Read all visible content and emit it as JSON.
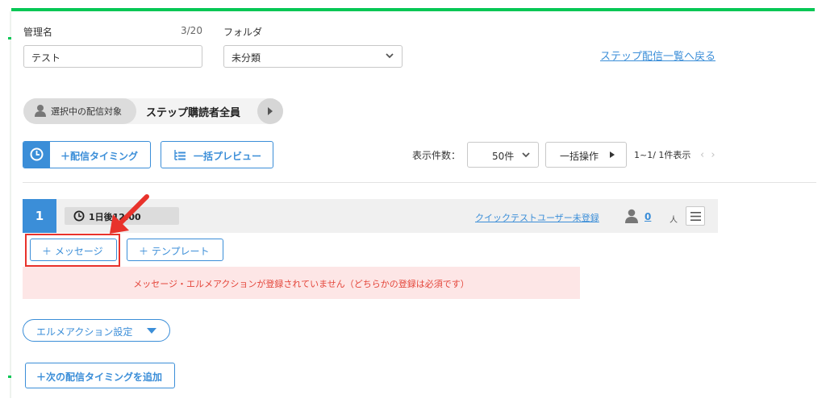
{
  "form": {
    "name_label": "管理名",
    "name_counter": "3/20",
    "name_value": "テスト",
    "folder_label": "フォルダ",
    "folder_value": "未分類",
    "back_link": "ステップ配信一覧へ戻る"
  },
  "target": {
    "label": "選択中の配信対象",
    "name": "ステップ購読者全員"
  },
  "toolbar": {
    "timing_button": "＋配信タイミング",
    "preview_button": "一括プレビュー",
    "display_count_label": "表示件数：",
    "display_count_value": "50件",
    "bulk_action_button": "一括操作",
    "range_text": "1~1/ 1件表示"
  },
  "step": {
    "number": "1",
    "time": "1日後12:00",
    "quick_test_link": "クイックテストユーザー未登録",
    "user_count": "0",
    "user_unit": "人",
    "message_button": "＋ メッセージ",
    "template_button": "＋ テンプレート",
    "error_text": "メッセージ・エルメアクションが登録されていません（どちらかの登録は必須です）",
    "action_setting_button": "エルメアクション設定"
  },
  "footer": {
    "add_next_timing_button": "＋次の配信タイミングを追加"
  },
  "colors": {
    "accent": "#3b8ed8",
    "brand_green": "#06c755",
    "error_text": "#e4453a",
    "error_bg": "#fde6e6",
    "annotation_red": "#e8322b"
  }
}
